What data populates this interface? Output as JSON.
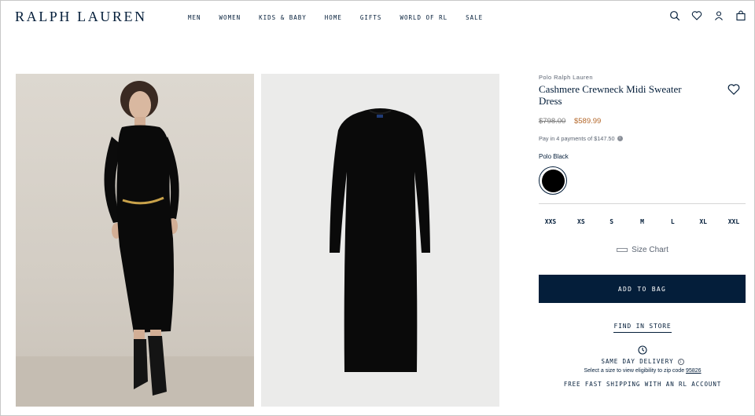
{
  "header": {
    "logo": "RALPH LAUREN",
    "nav": [
      "MEN",
      "WOMEN",
      "KIDS & BABY",
      "HOME",
      "GIFTS",
      "WORLD OF RL",
      "SALE"
    ]
  },
  "product": {
    "brand": "Polo Ralph Lauren",
    "title": "Cashmere Crewneck Midi Sweater Dress",
    "original_price": "$798.00",
    "sale_price": "$589.99",
    "payments": "Pay in 4 payments of $147.50",
    "color_name": "Polo Black",
    "color_hex": "#000000",
    "sizes": [
      "XXS",
      "XS",
      "S",
      "M",
      "L",
      "XL",
      "XXL"
    ],
    "size_chart": "Size Chart",
    "add_to_bag": "ADD TO BAG",
    "find_in_store": "FIND IN STORE",
    "same_day": "SAME DAY DELIVERY",
    "select_size_text": "Select a size to view eligibility to zip code",
    "zip": "95826",
    "free_shipping": "FREE FAST SHIPPING WITH AN RL ACCOUNT"
  },
  "colors": {
    "navy": "#041e3a",
    "sale": "#b3672a"
  }
}
